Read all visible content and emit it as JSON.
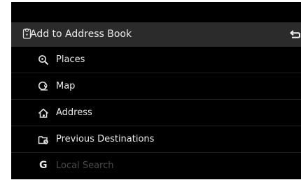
{
  "header": {
    "title": "Add to Address Book",
    "icon": "address-book-pin-icon",
    "back_icon": "back-arrow-icon"
  },
  "menu": {
    "items": [
      {
        "label": "Places",
        "icon": "search-places-icon",
        "enabled": true
      },
      {
        "label": "Map",
        "icon": "map-pin-icon",
        "enabled": true
      },
      {
        "label": "Address",
        "icon": "address-home-icon",
        "enabled": true
      },
      {
        "label": "Previous Destinations",
        "icon": "folder-clock-icon",
        "enabled": true
      },
      {
        "label": "Local Search",
        "icon": "google-g-icon",
        "enabled": false
      }
    ]
  },
  "colors": {
    "background": "#000000",
    "header": "#2b2b2b",
    "text": "#e8e8e8",
    "disabled_text": "#4a4a4a"
  }
}
